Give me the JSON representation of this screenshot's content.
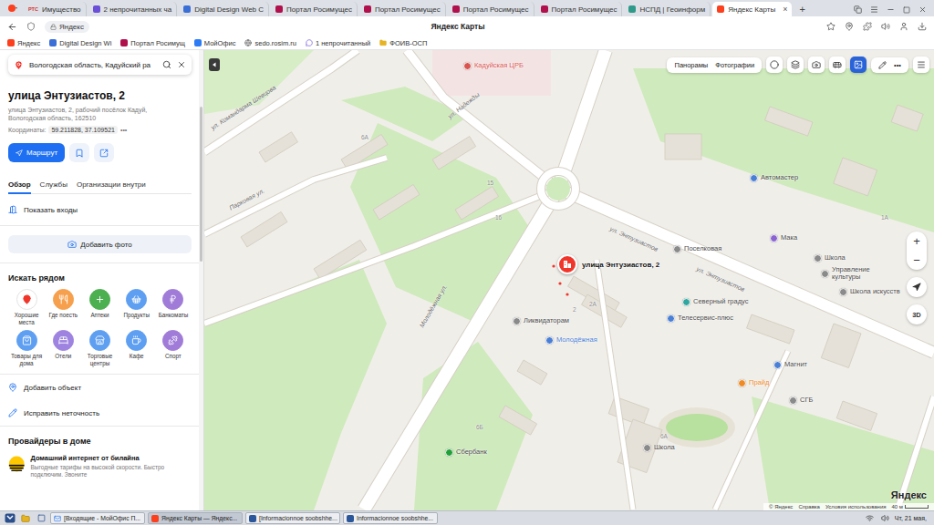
{
  "browser": {
    "tabs": [
      {
        "label": "Имущество",
        "badge": "РТС",
        "kind": "rts",
        "selected": false
      },
      {
        "label": "2 непрочитанных ча",
        "kind": "chat",
        "selected": false
      },
      {
        "label": "Digital Design Web С",
        "kind": "dd",
        "selected": false
      },
      {
        "label": "Портал Росимущес",
        "kind": "rosim",
        "selected": false
      },
      {
        "label": "Портал Росимущес",
        "kind": "rosim",
        "selected": false
      },
      {
        "label": "Портал Росимущес",
        "kind": "rosim",
        "selected": false
      },
      {
        "label": "Портал Росимущес",
        "kind": "rosim",
        "selected": false
      },
      {
        "label": "НСПД | Геоинформ",
        "kind": "nspd",
        "selected": false
      },
      {
        "label": "Яндекс Карты",
        "kind": "yandex",
        "selected": true
      }
    ],
    "new_tab": "+",
    "close_tab": "×",
    "address": "Яндекс",
    "page_title": "Яндекс Карты",
    "bookmarks": [
      {
        "label": "Яндекс",
        "kind": "yandex"
      },
      {
        "label": "Digital Design Wi",
        "kind": "dd"
      },
      {
        "label": "Портал Росимущ",
        "kind": "rosim"
      },
      {
        "label": "МойОфис",
        "kind": "office"
      },
      {
        "label": "sedo.rosim.ru",
        "kind": "globe"
      },
      {
        "label": "1 непрочитанный",
        "kind": "chat"
      },
      {
        "label": "ФОИВ-ОСП",
        "kind": "folder"
      }
    ]
  },
  "sidebar": {
    "search": {
      "value": "Вологодская область, Кадуйский ра"
    },
    "place": {
      "title": "улица Энтузиастов, 2",
      "address": "улица Энтузиастов, 2, рабочий посёлок Кадуй, Вологодская область, 162510",
      "coordinates_label": "Координаты:",
      "coordinates": "59.211828, 37.109521",
      "more": "•••"
    },
    "route": "Маршрут",
    "tabs": [
      {
        "label": "Обзор",
        "selected": true
      },
      {
        "label": "Службы",
        "selected": false
      },
      {
        "label": "Организации внутри",
        "selected": false
      }
    ],
    "show_entrances": "Показать входы",
    "add_photo": "Добавить фото",
    "nearby": {
      "title": "Искать рядом",
      "items": [
        {
          "label": "Хорошие места",
          "color": "#ffffff"
        },
        {
          "label": "Где поесть",
          "color": "#f6a04d"
        },
        {
          "label": "Аптеки",
          "color": "#4caf50"
        },
        {
          "label": "Продукты",
          "color": "#5e9ff2"
        },
        {
          "label": "Банкоматы",
          "color": "#a07cd8"
        },
        {
          "label": "Товары для дома",
          "color": "#5e9ff2"
        },
        {
          "label": "Отели",
          "color": "#9e84e0"
        },
        {
          "label": "Торговые центры",
          "color": "#5e9ff2"
        },
        {
          "label": "Кафе",
          "color": "#5e9ff2"
        },
        {
          "label": "Спорт",
          "color": "#a07cd8"
        }
      ]
    },
    "actions": [
      {
        "label": "Добавить объект"
      },
      {
        "label": "Исправить неточность"
      }
    ],
    "providers": {
      "title": "Провайдеры в доме",
      "name": "Домашний интернет от билайна",
      "description": "Выгодные тарифы на высокой скорости. Быстро подключим. Звоните"
    }
  },
  "map": {
    "pin": {
      "label": "улица Энтузиастов, 2"
    },
    "labels": [
      {
        "text": "Кадуйская ЦРБ",
        "kind": "place",
        "color": "#d9534f"
      },
      {
        "text": "ул. Надежды",
        "kind": "street",
        "color": "#6b6b6b"
      },
      {
        "text": "ул. Командарма Шевцова",
        "kind": "street",
        "color": "#6b6b6b"
      },
      {
        "text": "Парковая ул.",
        "kind": "street",
        "color": "#6b6b6b"
      },
      {
        "text": "Молодёжная ул.",
        "kind": "street",
        "color": "#6b6b6b"
      },
      {
        "text": "ул. Энтузиастов",
        "kind": "street",
        "color": "#6b6b6b"
      },
      {
        "text": "ул. Энтузиастов",
        "kind": "street",
        "color": "#6b6b6b"
      },
      {
        "text": "Автомастер",
        "kind": "poi",
        "color": "#4a7fd6"
      },
      {
        "text": "Поселковая",
        "kind": "poi",
        "color": "#8a8a8a"
      },
      {
        "text": "Мака",
        "kind": "poi",
        "color": "#8a63d2"
      },
      {
        "text": "Школа",
        "kind": "poi",
        "color": "#8a8a8a"
      },
      {
        "text": "Управление культуры",
        "kind": "poi",
        "color": "#8a8a8a"
      },
      {
        "text": "Школа искусств",
        "kind": "poi",
        "color": "#8a8a8a"
      },
      {
        "text": "Северный градус",
        "kind": "poi",
        "color": "#2fa7a0"
      },
      {
        "text": "Телесервис-плюс",
        "kind": "poi",
        "color": "#4a7fd6"
      },
      {
        "text": "Ликвидаторам",
        "kind": "poi",
        "color": "#8a8a8a"
      },
      {
        "text": "Молодёжная",
        "kind": "place",
        "color": "#4a7fd6"
      },
      {
        "text": "Магнит",
        "kind": "poi",
        "color": "#4a7fd6"
      },
      {
        "text": "Прайд",
        "kind": "place",
        "color": "#f08a24"
      },
      {
        "text": "СГБ",
        "kind": "poi",
        "color": "#8a8a8a"
      },
      {
        "text": "Сбербанк",
        "kind": "poi",
        "color": "#21a038"
      },
      {
        "text": "Школа",
        "kind": "poi",
        "color": "#8a8a8a"
      },
      {
        "text": "15",
        "kind": "house",
        "color": "#8c8c8c"
      },
      {
        "text": "16",
        "kind": "house",
        "color": "#8c8c8c"
      },
      {
        "text": "6А",
        "kind": "house",
        "color": "#8c8c8c"
      },
      {
        "text": "2",
        "kind": "house",
        "color": "#8c8c8c"
      },
      {
        "text": "2А",
        "kind": "house",
        "color": "#8c8c8c"
      },
      {
        "text": "1А",
        "kind": "house",
        "color": "#8c8c8c"
      },
      {
        "text": "6А",
        "kind": "house",
        "color": "#8c8c8c"
      },
      {
        "text": "6Б",
        "kind": "house",
        "color": "#8c8c8c"
      }
    ],
    "controls": {
      "panoramas": "Панорамы",
      "photos": "Фотографии",
      "more": "•••",
      "zoom_in": "+",
      "zoom_out": "−",
      "three_d": "3D"
    },
    "footer": {
      "copyright": "© Яндекс",
      "help": "Справка",
      "terms": "Условия использования",
      "scale": "40 м"
    },
    "logo": "Яндекс"
  },
  "taskbar": {
    "items": [
      {
        "label": "[Входящие - МойОфис П...",
        "selected": false
      },
      {
        "label": "Яндекс Карты — Яндекс...",
        "selected": true
      },
      {
        "label": "[Informacionnoe soobshhe...",
        "selected": false
      },
      {
        "label": "Informacionnoe soobshhe...",
        "selected": false
      }
    ],
    "clock": "Чт, 21 мая,"
  }
}
